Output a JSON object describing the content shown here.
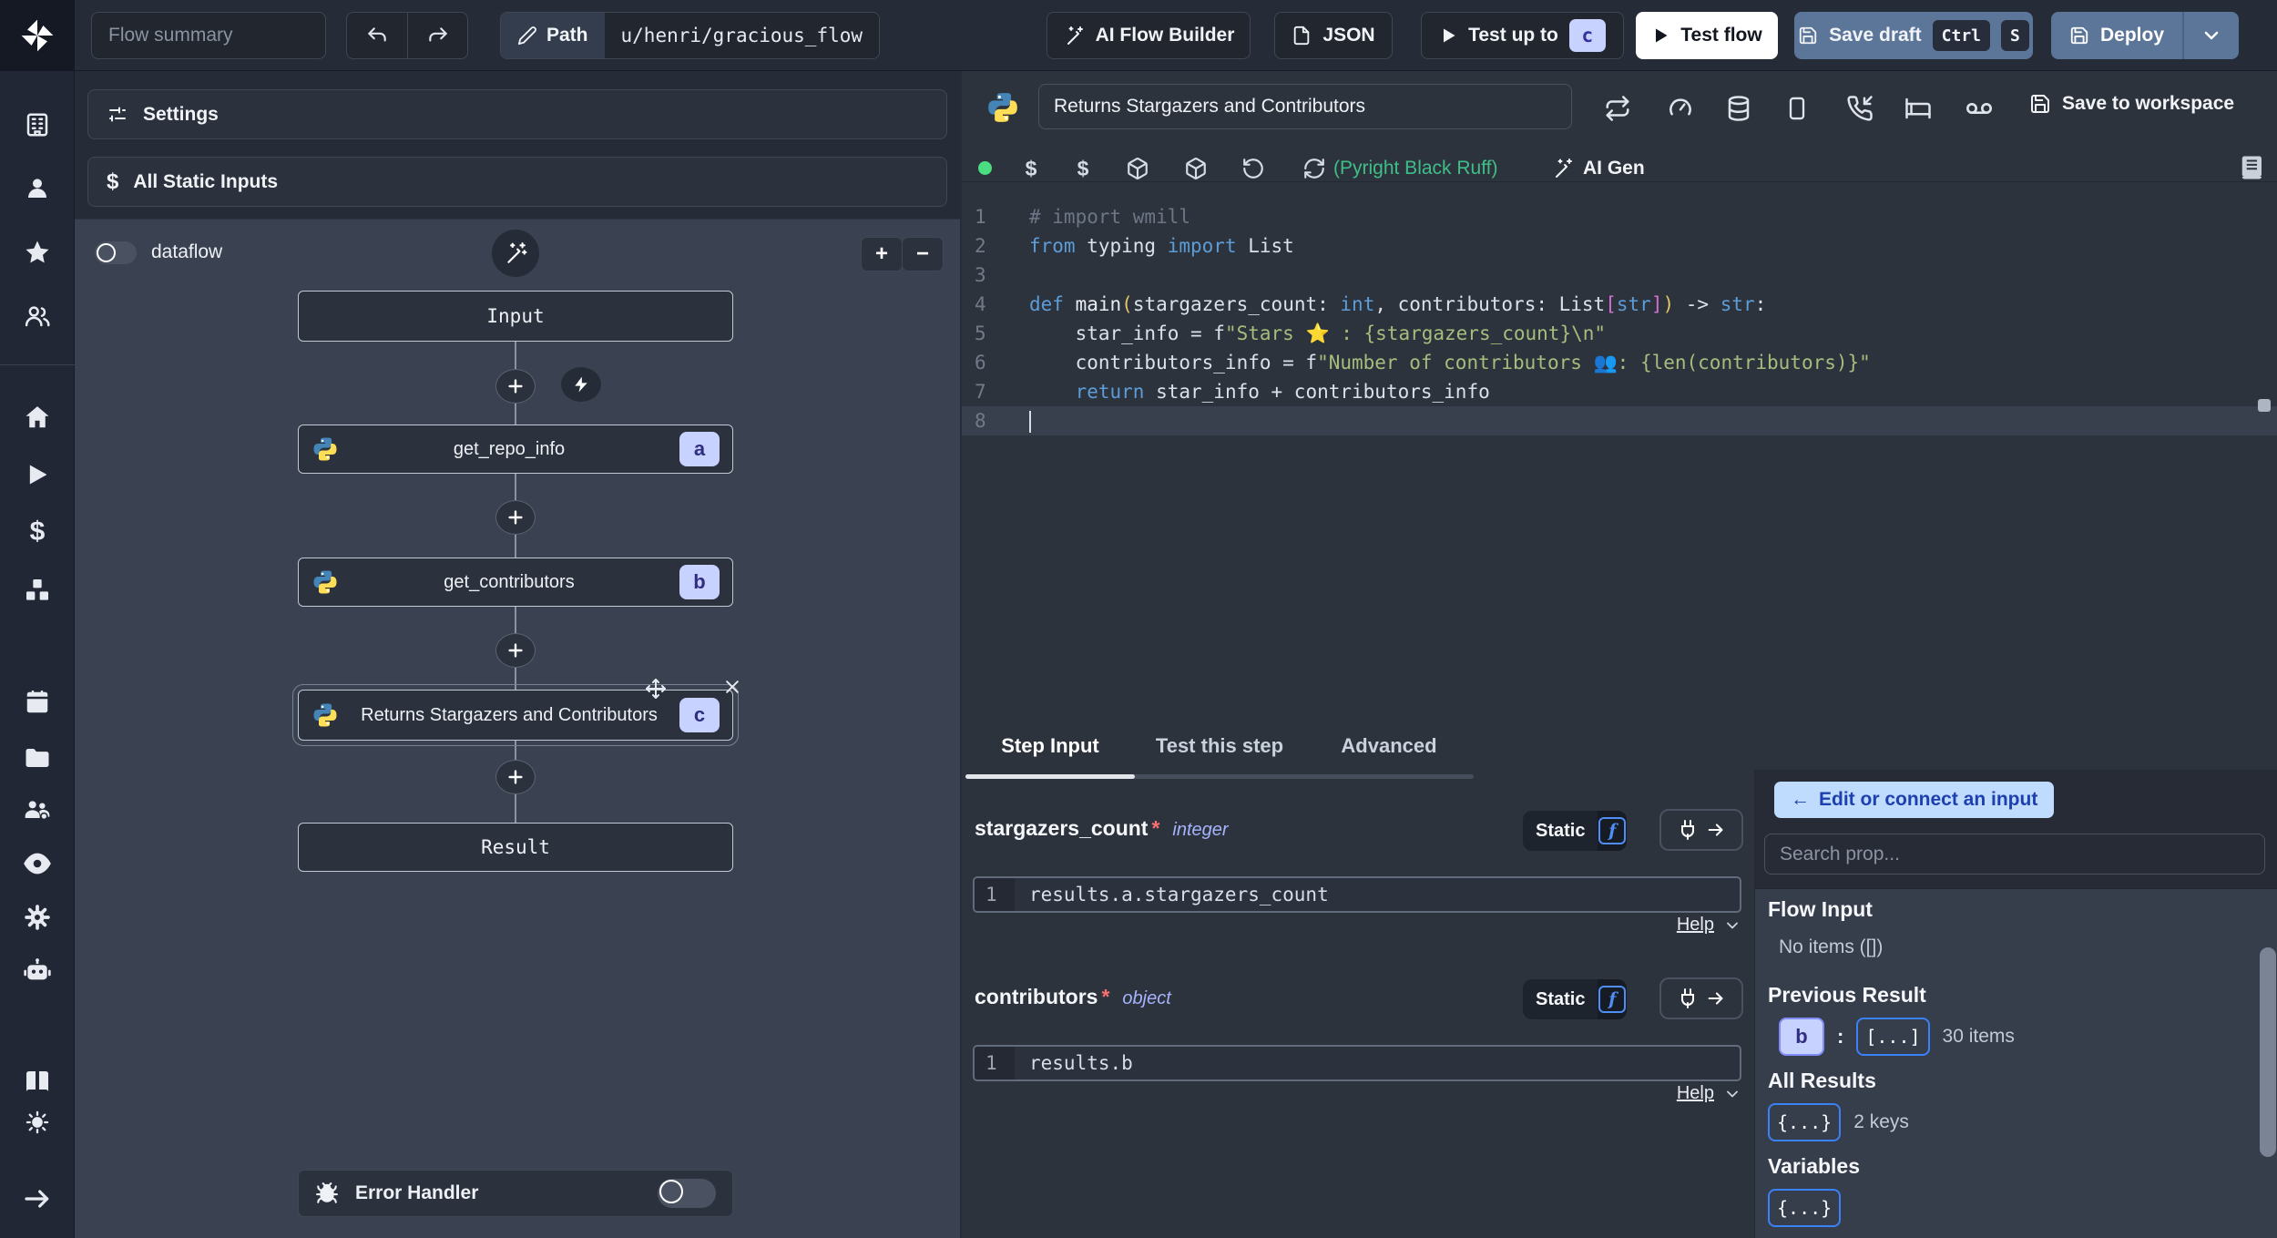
{
  "topbar": {
    "flow_summary_placeholder": "Flow summary",
    "path_label": "Path",
    "path_value": "u/henri/gracious_flow",
    "ai_flow_builder": "AI Flow Builder",
    "json_button": "JSON",
    "test_up_to": "Test up to",
    "test_up_to_badge": "c",
    "test_flow": "Test flow",
    "save_draft": "Save draft",
    "key_ctrl": "Ctrl",
    "key_s": "S",
    "deploy": "Deploy"
  },
  "left_panel": {
    "settings": "Settings",
    "all_static_inputs": "All Static Inputs",
    "dataflow": "dataflow",
    "zoom_in": "+",
    "zoom_out": "−",
    "graph": {
      "input": "Input",
      "result": "Result",
      "modules": [
        {
          "label": "get_repo_info",
          "badge": "a"
        },
        {
          "label": "get_contributors",
          "badge": "b"
        },
        {
          "label": "Returns Stargazers and Contributors",
          "badge": "c"
        }
      ],
      "error_handler": "Error Handler"
    }
  },
  "editor": {
    "title": "Returns Stargazers and Contributors",
    "save_to_workspace": "Save to workspace",
    "lint_status": "(Pyright Black Ruff)",
    "ai_gen": "AI Gen",
    "code_lines": [
      {
        "n": "1",
        "tokens": [
          [
            "cm",
            "# import wmill"
          ]
        ]
      },
      {
        "n": "2",
        "tokens": [
          [
            "kw",
            "from"
          ],
          [
            "pl",
            " typing "
          ],
          [
            "kw",
            "import"
          ],
          [
            "pl",
            " List"
          ]
        ]
      },
      {
        "n": "3",
        "tokens": []
      },
      {
        "n": "4",
        "tokens": [
          [
            "kw",
            "def"
          ],
          [
            "pl",
            " "
          ],
          [
            "fn",
            "main"
          ],
          [
            "pa",
            "("
          ],
          [
            "pl",
            "stargazers_count: "
          ],
          [
            "ty",
            "int"
          ],
          [
            "pl",
            ", contributors: List"
          ],
          [
            "br",
            "["
          ],
          [
            "ty",
            "str"
          ],
          [
            "br",
            "]"
          ],
          [
            "pa",
            ")"
          ],
          [
            "pl",
            " -> "
          ],
          [
            "ty",
            "str"
          ],
          [
            "pl",
            ":"
          ]
        ]
      },
      {
        "n": "5",
        "tokens": [
          [
            "pl",
            "    star_info = f"
          ],
          [
            "st",
            "\"Stars ⭐ : {stargazers_count}\\n\""
          ]
        ]
      },
      {
        "n": "6",
        "tokens": [
          [
            "pl",
            "    contributors_info = f"
          ],
          [
            "st",
            "\"Number of contributors 👥: {len(contributors)}\""
          ]
        ]
      },
      {
        "n": "7",
        "tokens": [
          [
            "kw",
            "    return"
          ],
          [
            "pl",
            " star_info + contributors_info"
          ]
        ]
      },
      {
        "n": "8",
        "tokens": [],
        "active": true,
        "cursor": true
      }
    ]
  },
  "step_panel": {
    "tabs": [
      "Step Input",
      "Test this step",
      "Advanced"
    ],
    "fields": [
      {
        "name": "stargazers_count",
        "required": "*",
        "type": "integer",
        "mode": "Static",
        "line": "1",
        "expr": "results.a.stargazers_count",
        "help": "Help"
      },
      {
        "name": "contributors",
        "required": "*",
        "type": "object",
        "mode": "Static",
        "line": "1",
        "expr": "results.b",
        "help": "Help"
      }
    ]
  },
  "connect_panel": {
    "edit_arrow": "←",
    "edit_button": "Edit or connect an input",
    "search_placeholder": "Search prop...",
    "flow_input_title": "Flow Input",
    "flow_input_empty": "No items ([])",
    "previous_result_title": "Previous Result",
    "previous_result_badge": "b",
    "previous_result_colon": ":",
    "previous_result_collapsed": "[...]",
    "previous_result_meta": "30 items",
    "all_results_title": "All Results",
    "all_results_collapsed": "{...}",
    "all_results_meta": "2 keys",
    "variables_title": "Variables",
    "variables_collapsed": "{...}"
  },
  "colors": {
    "badge_bg": "#c7d2fe",
    "badge_text": "#312e81",
    "accent_blue": "#3b82f6",
    "save_button_bg": "#5b7699",
    "success_green": "#4ade80",
    "lint_green": "#3fbf87"
  }
}
